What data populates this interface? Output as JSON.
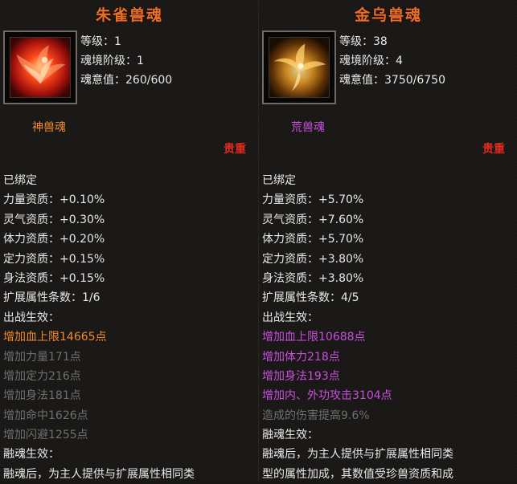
{
  "colors": {
    "title": "#e8702a",
    "text": "#e8e8e8",
    "orange": "#f28a2d",
    "purple": "#c94fe0",
    "gray": "#6f6f6f",
    "rarity_red": "#e32b1e"
  },
  "left": {
    "title": "朱雀兽魂",
    "icon": "vermilion-bird-icon",
    "level": "等级：1",
    "realm": "魂境阶级：1",
    "soul_value": "魂意值：260/600",
    "soul_type": "神兽魂",
    "soul_type_color": "#f28a2d",
    "rarity": "贵重",
    "rows": [
      {
        "text": "已绑定",
        "color": "#e8e8e8"
      },
      {
        "text": "力量资质：+0.10%",
        "color": "#e8e8e8"
      },
      {
        "text": "灵气资质：+0.30%",
        "color": "#e8e8e8"
      },
      {
        "text": "体力资质：+0.20%",
        "color": "#e8e8e8"
      },
      {
        "text": "定力资质：+0.15%",
        "color": "#e8e8e8"
      },
      {
        "text": "身法资质：+0.15%",
        "color": "#e8e8e8"
      },
      {
        "text": "扩展属性条数：1/6",
        "color": "#e8e8e8"
      },
      {
        "text": "出战生效：",
        "color": "#e8e8e8"
      },
      {
        "text": "增加血上限14665点",
        "color": "#f28a2d"
      },
      {
        "text": "增加力量171点",
        "color": "#6f6f6f"
      },
      {
        "text": "增加定力216点",
        "color": "#6f6f6f"
      },
      {
        "text": "增加身法181点",
        "color": "#6f6f6f"
      },
      {
        "text": "增加命中1626点",
        "color": "#6f6f6f"
      },
      {
        "text": "增加闪避1255点",
        "color": "#6f6f6f"
      },
      {
        "text": "融魂生效：",
        "color": "#e8e8e8"
      },
      {
        "text": "融魂后，为主人提供与扩展属性相同类",
        "color": "#e8e8e8"
      }
    ]
  },
  "right": {
    "title": "金乌兽魂",
    "icon": "golden-crow-icon",
    "level": "等级：38",
    "realm": "魂境阶级：4",
    "soul_value": "魂意值：3750/6750",
    "soul_type": "荒兽魂",
    "soul_type_color": "#c94fe0",
    "rarity": "贵重",
    "rows": [
      {
        "text": "已绑定",
        "color": "#e8e8e8"
      },
      {
        "text": "力量资质：+5.70%",
        "color": "#e8e8e8"
      },
      {
        "text": "灵气资质：+7.60%",
        "color": "#e8e8e8"
      },
      {
        "text": "体力资质：+5.70%",
        "color": "#e8e8e8"
      },
      {
        "text": "定力资质：+3.80%",
        "color": "#e8e8e8"
      },
      {
        "text": "身法资质：+3.80%",
        "color": "#e8e8e8"
      },
      {
        "text": "扩展属性条数：4/5",
        "color": "#e8e8e8"
      },
      {
        "text": "出战生效：",
        "color": "#e8e8e8"
      },
      {
        "text": "增加血上限10688点",
        "color": "#c94fe0"
      },
      {
        "text": "增加体力218点",
        "color": "#c94fe0"
      },
      {
        "text": "增加身法193点",
        "color": "#c94fe0"
      },
      {
        "text": "增加内、外功攻击3104点",
        "color": "#c94fe0"
      },
      {
        "text": "造成的伤害提高9.6%",
        "color": "#6f6f6f"
      },
      {
        "text": "融魂生效：",
        "color": "#e8e8e8"
      },
      {
        "text": "融魂后，为主人提供与扩展属性相同类",
        "color": "#e8e8e8"
      },
      {
        "text": "型的属性加成，其数值受珍兽资质和成",
        "color": "#e8e8e8"
      }
    ]
  }
}
